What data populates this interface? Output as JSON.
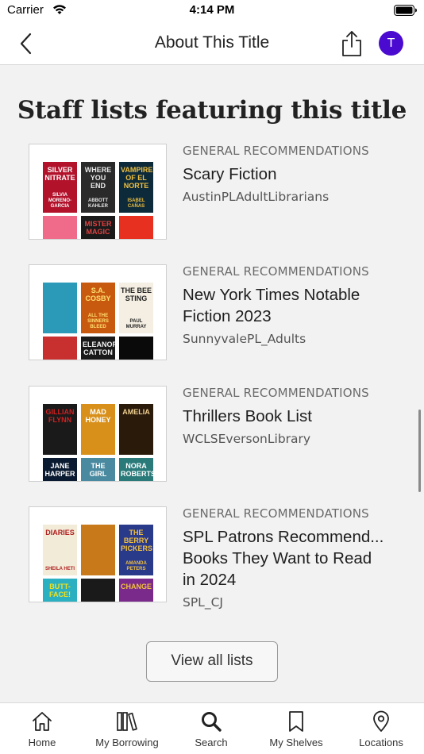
{
  "status_bar": {
    "carrier": "Carrier",
    "time": "4:14 PM"
  },
  "nav": {
    "title": "About This Title",
    "avatar_initial": "T"
  },
  "section": {
    "title": "Staff lists featuring this title"
  },
  "lists": [
    {
      "category": "GENERAL RECOMMENDATIONS",
      "title_lines": [
        "Scary Fiction"
      ],
      "user": "AustinPLAdultLibrarians",
      "covers": [
        {
          "text": "SILVER NITRATE",
          "sub": "SILVIA MORENO-GARCIA",
          "bg": "#b3122b",
          "fg": "#ffffff"
        },
        {
          "text": "WHERE YOU END",
          "sub": "ABBOTT KAHLER",
          "bg": "#2a2a2a",
          "fg": "#e8e8e8"
        },
        {
          "text": "VAMPIRES OF EL NORTE",
          "sub": "ISABEL CAÑAS",
          "bg": "#0d2a3a",
          "fg": "#f0c040"
        },
        {
          "text": "",
          "sub": "",
          "bg": "#f06a8a",
          "fg": "#ffffff"
        },
        {
          "text": "MISTER MAGIC",
          "sub": "",
          "bg": "#1a1a1a",
          "fg": "#e04040"
        },
        {
          "text": "",
          "sub": "",
          "bg": "#e83020",
          "fg": "#ffffff"
        }
      ]
    },
    {
      "category": "GENERAL RECOMMENDATIONS",
      "title_lines": [
        "New York Times Notable",
        "Fiction 2023"
      ],
      "user": "SunnyvalePL_Adults",
      "covers": [
        {
          "text": "",
          "sub": "",
          "bg": "#2a9ab8",
          "fg": "#ffffff"
        },
        {
          "text": "S.A. COSBY",
          "sub": "ALL THE SINNERS BLEED",
          "bg": "#c85a10",
          "fg": "#ffe070"
        },
        {
          "text": "THE BEE STING",
          "sub": "PAUL MURRAY",
          "bg": "#f4efe2",
          "fg": "#222222"
        },
        {
          "text": "",
          "sub": "",
          "bg": "#c83030",
          "fg": "#ffffff"
        },
        {
          "text": "ELEANOR CATTON",
          "sub": "",
          "bg": "#1a1a1a",
          "fg": "#f0f0f0"
        },
        {
          "text": "",
          "sub": "",
          "bg": "#0a0a0a",
          "fg": "#ffffff"
        }
      ]
    },
    {
      "category": "GENERAL RECOMMENDATIONS",
      "title_lines": [
        "Thrillers Book List"
      ],
      "user": "WCLSEversonLibrary",
      "covers": [
        {
          "text": "GILLIAN FLYNN",
          "sub": "",
          "bg": "#1a1a1a",
          "fg": "#d02020"
        },
        {
          "text": "MAD HONEY",
          "sub": "",
          "bg": "#d8901a",
          "fg": "#ffffff"
        },
        {
          "text": "AMELIA",
          "sub": "",
          "bg": "#2a1a0a",
          "fg": "#f0d090"
        },
        {
          "text": "JANE HARPER",
          "sub": "",
          "bg": "#0a1a30",
          "fg": "#ffffff"
        },
        {
          "text": "THE GIRL",
          "sub": "",
          "bg": "#4a8aa0",
          "fg": "#ffffff"
        },
        {
          "text": "NORA ROBERTS",
          "sub": "",
          "bg": "#2a7a7a",
          "fg": "#ffffff"
        }
      ]
    },
    {
      "category": "GENERAL RECOMMENDATIONS",
      "title_lines": [
        "SPL Patrons Recommend...",
        "Books They Want to Read",
        "in 2024"
      ],
      "user": "SPL_CJ",
      "covers": [
        {
          "text": "DIARIES",
          "sub": "SHEILA HETI",
          "bg": "#f2ebd8",
          "fg": "#b02020"
        },
        {
          "text": "",
          "sub": "",
          "bg": "#c87a1a",
          "fg": "#ffffff"
        },
        {
          "text": "THE BERRY PICKERS",
          "sub": "AMANDA PETERS",
          "bg": "#2a3a8a",
          "fg": "#f0c040"
        },
        {
          "text": "BUTT-FACE!",
          "sub": "",
          "bg": "#2ab0c0",
          "fg": "#f0e020"
        },
        {
          "text": "",
          "sub": "",
          "bg": "#1a1a1a",
          "fg": "#ffffff"
        },
        {
          "text": "CHANGE",
          "sub": "",
          "bg": "#7a2a8a",
          "fg": "#f0c040"
        }
      ]
    }
  ],
  "view_all_label": "View all lists",
  "tabs": [
    {
      "label": "Home",
      "icon": "home-icon"
    },
    {
      "label": "My Borrowing",
      "icon": "books-icon"
    },
    {
      "label": "Search",
      "icon": "search-icon"
    },
    {
      "label": "My Shelves",
      "icon": "bookmark-icon"
    },
    {
      "label": "Locations",
      "icon": "map-pin-icon"
    }
  ]
}
